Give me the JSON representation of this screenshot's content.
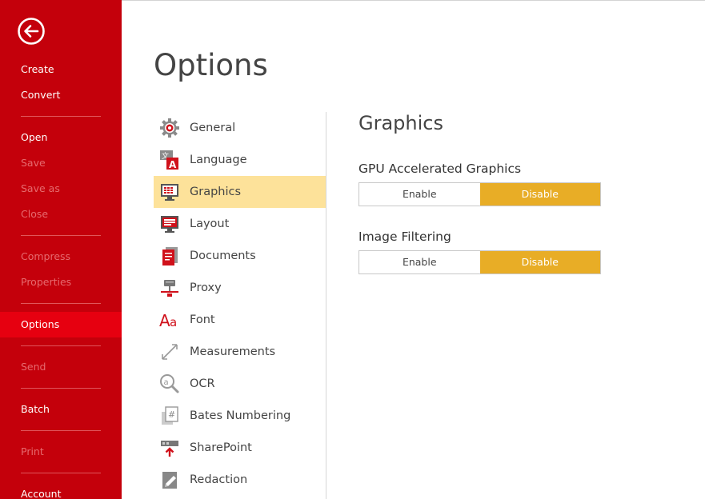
{
  "sidebar": {
    "back_icon": "arrow-left-circle-icon",
    "items": [
      {
        "label": "Create",
        "state": "enabled"
      },
      {
        "label": "Convert",
        "state": "enabled"
      },
      {
        "label": "Open",
        "state": "enabled"
      },
      {
        "label": "Save",
        "state": "disabled"
      },
      {
        "label": "Save as",
        "state": "disabled"
      },
      {
        "label": "Close",
        "state": "disabled"
      },
      {
        "label": "Compress",
        "state": "disabled"
      },
      {
        "label": "Properties",
        "state": "disabled"
      },
      {
        "label": "Options",
        "state": "selected"
      },
      {
        "label": "Send",
        "state": "disabled"
      },
      {
        "label": "Batch",
        "state": "enabled"
      },
      {
        "label": "Print",
        "state": "disabled"
      },
      {
        "label": "Account",
        "state": "enabled"
      }
    ]
  },
  "page": {
    "title": "Options"
  },
  "categories": [
    {
      "label": "General",
      "icon": "gear-icon"
    },
    {
      "label": "Language",
      "icon": "language-icon"
    },
    {
      "label": "Graphics",
      "icon": "graphics-monitor-icon",
      "selected": true
    },
    {
      "label": "Layout",
      "icon": "layout-monitor-icon"
    },
    {
      "label": "Documents",
      "icon": "documents-icon"
    },
    {
      "label": "Proxy",
      "icon": "proxy-network-icon"
    },
    {
      "label": "Font",
      "icon": "font-icon"
    },
    {
      "label": "Measurements",
      "icon": "ruler-icon"
    },
    {
      "label": "OCR",
      "icon": "ocr-magnifier-icon"
    },
    {
      "label": "Bates Numbering",
      "icon": "bates-numbering-icon"
    },
    {
      "label": "SharePoint",
      "icon": "sharepoint-upload-icon"
    },
    {
      "label": "Redaction",
      "icon": "redaction-icon"
    }
  ],
  "panel": {
    "title": "Graphics",
    "settings": [
      {
        "label": "GPU Accelerated Graphics",
        "options": [
          "Enable",
          "Disable"
        ],
        "selected": "Disable"
      },
      {
        "label": "Image Filtering",
        "options": [
          "Enable",
          "Disable"
        ],
        "selected": "Disable"
      }
    ]
  },
  "colors": {
    "sidebar_bg": "#c4000b",
    "sidebar_selected": "#e60010",
    "category_selected": "#fde29a",
    "toggle_active": "#e8ad26"
  }
}
